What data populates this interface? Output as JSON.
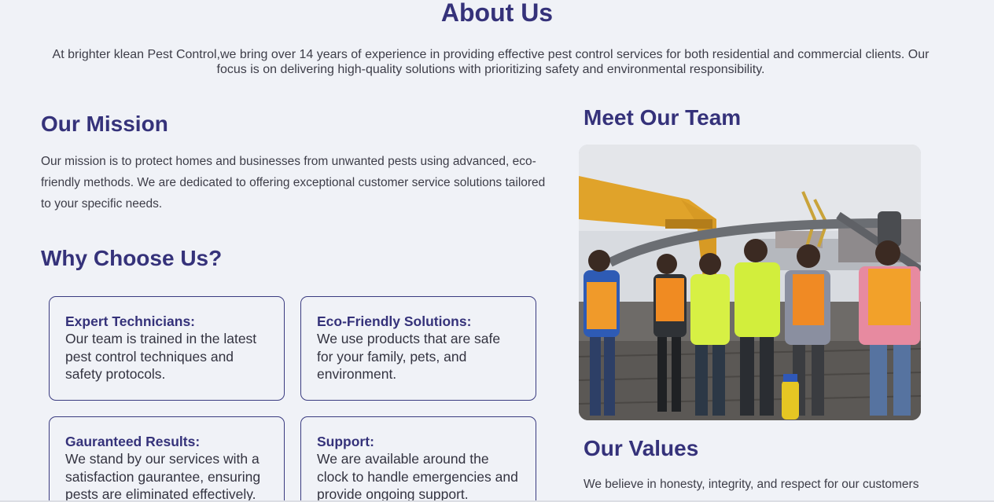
{
  "about": {
    "title": "About Us",
    "text": "At brighter klean Pest Control,we bring over 14 years of experience in providing effective pest control services for both residential and commercial clients. Our focus is on delivering high-quality solutions with prioritizing safety and environmental responsibility."
  },
  "mission": {
    "title": "Our Mission",
    "text": "Our mission is to protect homes and businesses from unwanted pests using advanced, eco-friendly methods. We are dedicated to offering exceptional customer service solutions tailored to your specific needs."
  },
  "why": {
    "title": "Why Choose Us?",
    "cards": [
      {
        "title": "Expert Technicians:",
        "text": "Our team is trained in the latest pest control techniques and safety protocols."
      },
      {
        "title": "Eco-Friendly Solutions:",
        "text": "We use products that are safe for your family, pets, and environment."
      },
      {
        "title": "Gauranteed Results:",
        "text": "We stand by our services with a satisfaction gaurantee, ensuring pests are eliminated effectively."
      },
      {
        "title": "Support:",
        "text": "We are available around the clock to handle emergencies and provide ongoing support."
      }
    ]
  },
  "team": {
    "title": "Meet Our Team"
  },
  "values": {
    "title": "Our Values",
    "text": "We believe in honesty, integrity, and respect for our customers"
  },
  "colors": {
    "heading": "#35327a",
    "background": "#f0f2f7",
    "card_border": "#3a3b80"
  }
}
